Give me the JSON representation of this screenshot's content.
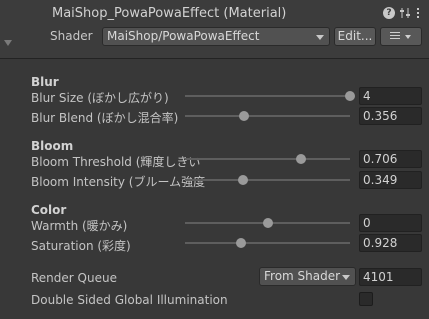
{
  "header": {
    "title": "MaiShop_PowaPowaEffect (Material)",
    "help_icon_glyph": "?",
    "shader_label": "Shader",
    "shader_value": "MaiShop/PowaPowaEffect",
    "edit_label": "Edit...",
    "icons": [
      "help-icon",
      "preset-icon",
      "menu-icon",
      "list-icon"
    ]
  },
  "groups": {
    "blur": {
      "title": "Blur",
      "size": {
        "label": "Blur Size (ぼかし広がり)",
        "value": "4",
        "level": 1.0
      },
      "blend": {
        "label": "Blur Blend (ぼかし混合率)",
        "value": "0.356",
        "level": 0.356
      }
    },
    "bloom": {
      "title": "Bloom",
      "threshold": {
        "label": "Bloom Threshold (輝度しきい",
        "value": "0.706",
        "level": 0.706
      },
      "intensity": {
        "label": "Bloom Intensity (ブルーム強度",
        "value": "0.349",
        "level": 0.349
      }
    },
    "color": {
      "title": "Color",
      "warmth": {
        "label": "Warmth (暖かみ)",
        "value": "0",
        "level": 0.5
      },
      "saturation": {
        "label": "Saturation (彩度)",
        "value": "0.928",
        "level": 0.34
      }
    }
  },
  "render_queue": {
    "label": "Render Queue",
    "mode": "From Shader",
    "value": "4101"
  },
  "double_sided": {
    "label": "Double Sided Global Illumination",
    "checked": false
  },
  "colors": {
    "background": "#383838",
    "field": "#2a2a2a",
    "thumb": "#9a9a9a"
  }
}
